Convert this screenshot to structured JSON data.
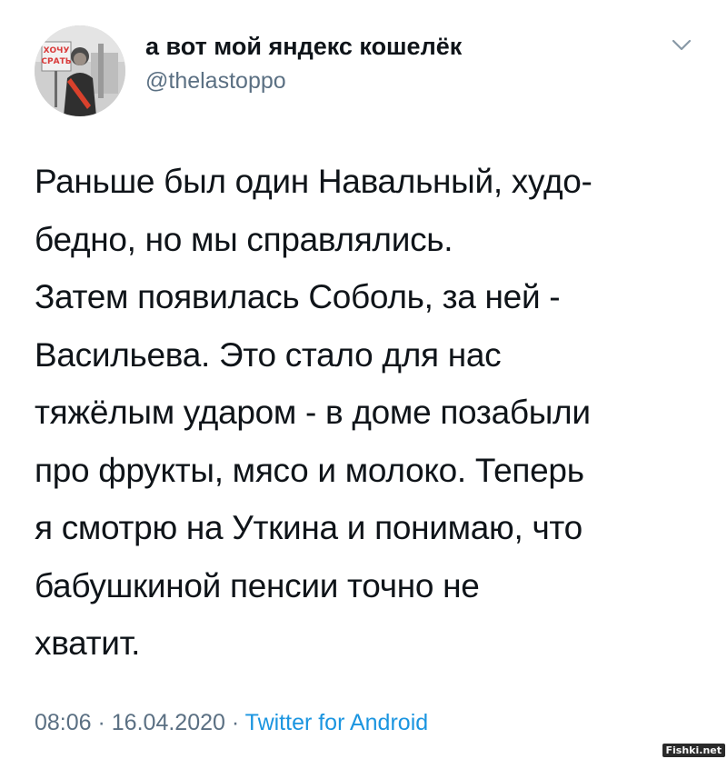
{
  "author": {
    "display_name": "а вот мой яндекс кошелёк",
    "handle": "@thelastoppo",
    "avatar_sign_text": "ХОЧУ СРАТЬ"
  },
  "menu": {
    "icon": "chevron-down-icon"
  },
  "tweet": {
    "lines": [
      "Раньше был один Навальный, худо-",
      "бедно, но мы справлялись.",
      "Затем появилась Соболь, за ней -",
      "Васильева. Это стало для нас",
      "тяжёлым ударом - в доме позабыли",
      "про фрукты, мясо и молоко. Теперь",
      "я смотрю на Уткина и понимаю, что",
      "бабушкиной пенсии точно не",
      "хватит."
    ]
  },
  "meta": {
    "time": "08:06",
    "separator": " · ",
    "date": "16.04.2020",
    "source": "Twitter for Android"
  },
  "watermark": "Fishki.net",
  "colors": {
    "text": "#0f1419",
    "muted": "#5b7083",
    "link": "#1b95e0"
  }
}
